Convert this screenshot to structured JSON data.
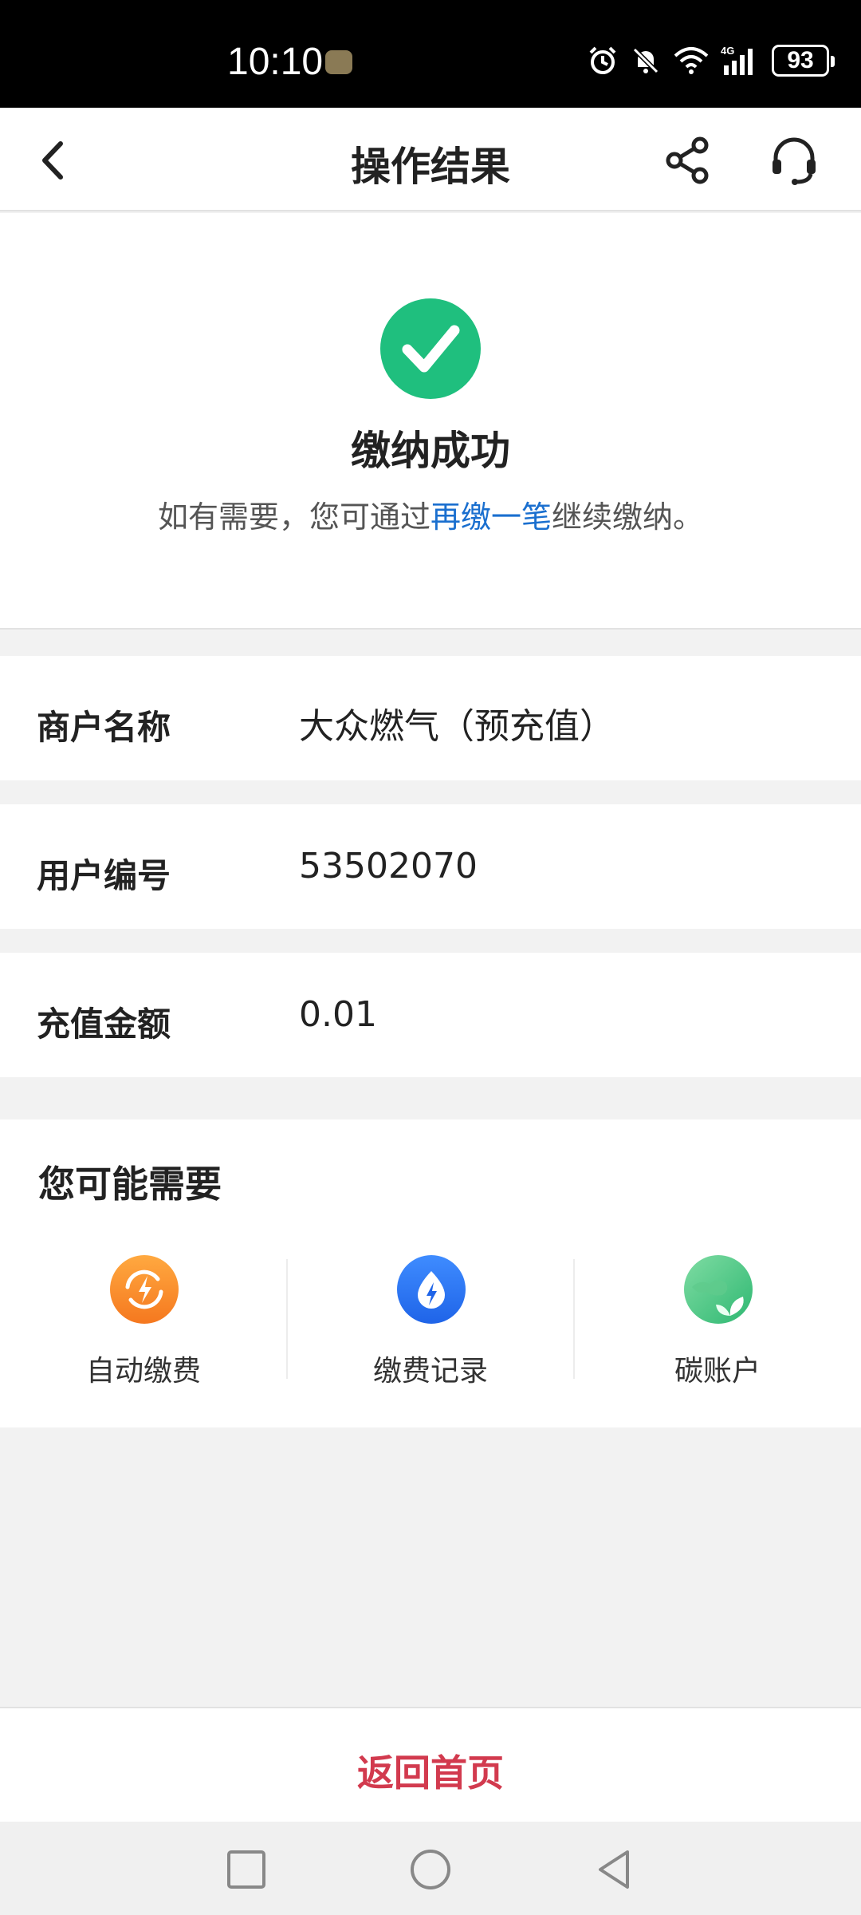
{
  "status_bar": {
    "time": "10:10",
    "battery": "93",
    "network": "4G"
  },
  "header": {
    "title": "操作结果"
  },
  "result": {
    "title": "缴纳成功",
    "desc_before": "如有需要，您可通过",
    "desc_link": "再缴一笔",
    "desc_after": "继续缴纳。"
  },
  "details": [
    {
      "label": "商户名称",
      "value": "大众燃气（预充值）"
    },
    {
      "label": "用户编号",
      "value": "53502070"
    },
    {
      "label": "充值金额",
      "value": "0.01"
    }
  ],
  "suggest": {
    "title": "您可能需要",
    "items": [
      {
        "label": "自动缴费",
        "icon": "auto-pay-icon"
      },
      {
        "label": "缴费记录",
        "icon": "payment-record-icon"
      },
      {
        "label": "碳账户",
        "icon": "carbon-account-icon"
      }
    ]
  },
  "footer": {
    "home_label": "返回首页"
  },
  "colors": {
    "success": "#1fbf7e",
    "link": "#1a6fcf",
    "footer_action": "#d23a4e"
  }
}
